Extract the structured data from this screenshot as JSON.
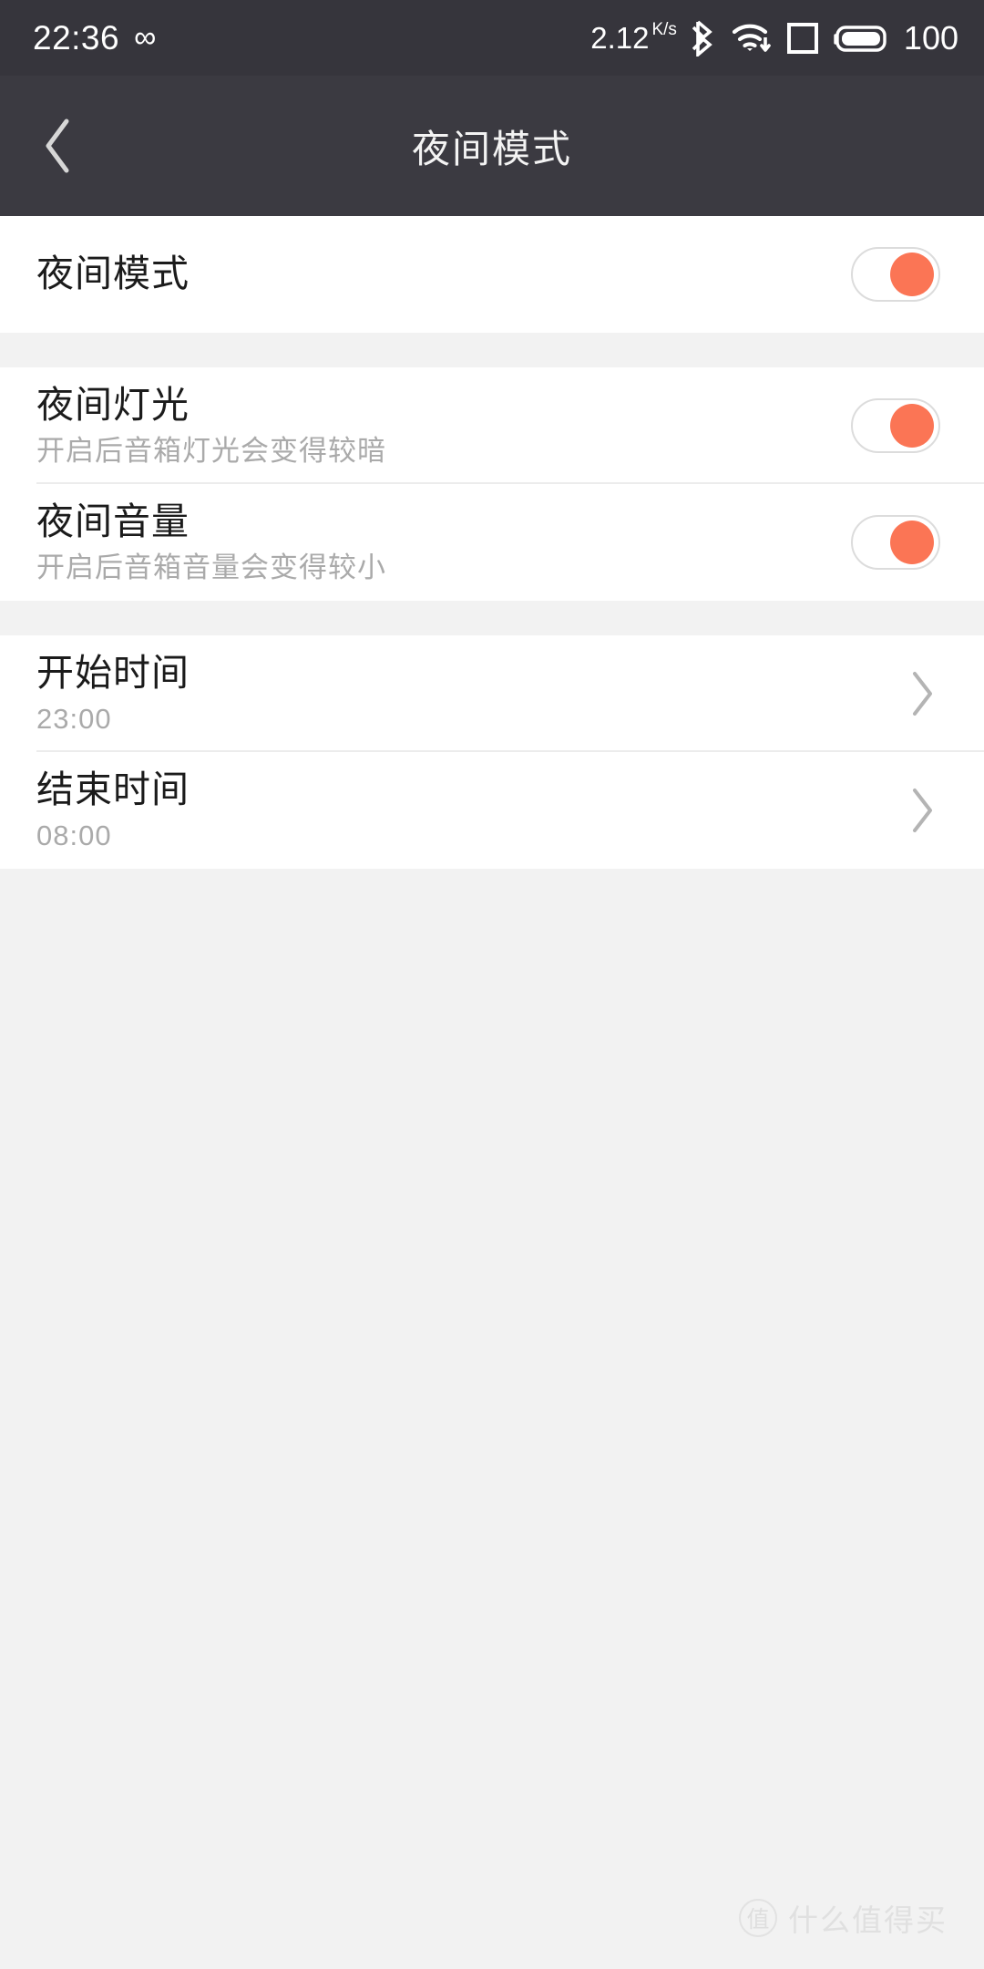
{
  "statusbar": {
    "clock": "22:36",
    "infinity_glyph": "∞",
    "net_speed": "2.12",
    "net_speed_unit": "K/s",
    "battery_percent": "100",
    "icons": [
      "bluetooth-icon",
      "wifi-download-icon",
      "sim-card-icon",
      "battery-icon"
    ],
    "bg_color": "#36353c",
    "fg_color": "#ffffff"
  },
  "titlebar": {
    "title": "夜间模式",
    "back_label": "‹",
    "bg_color": "#3b3a41"
  },
  "accent_color": "#fb7555",
  "sections": [
    {
      "rows": [
        {
          "title": "夜间模式",
          "subtitle": "",
          "control": "toggle",
          "value": "on"
        }
      ]
    },
    {
      "rows": [
        {
          "title": "夜间灯光",
          "subtitle": "开启后音箱灯光会变得较暗",
          "control": "toggle",
          "value": "on"
        },
        {
          "title": "夜间音量",
          "subtitle": "开启后音箱音量会变得较小",
          "control": "toggle",
          "value": "on"
        }
      ]
    },
    {
      "rows": [
        {
          "title": "开始时间",
          "subtitle": "23:00",
          "control": "chevron",
          "value": "23:00"
        },
        {
          "title": "结束时间",
          "subtitle": "08:00",
          "control": "chevron",
          "value": "08:00"
        }
      ]
    }
  ],
  "watermark": {
    "badge": "值",
    "text": "什么值得买"
  }
}
